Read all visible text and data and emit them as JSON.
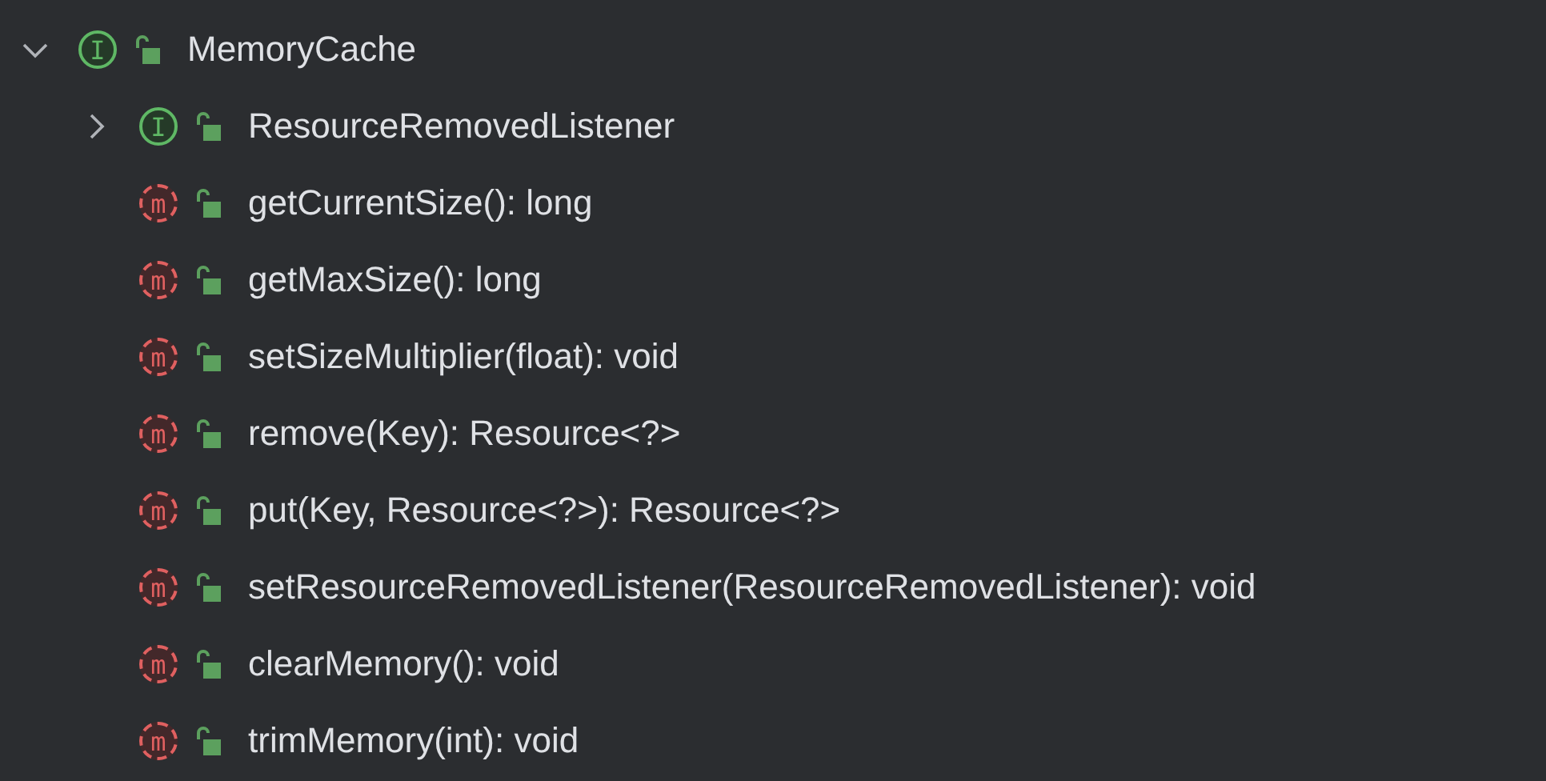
{
  "tree": [
    {
      "kind": "interface",
      "badge": "I",
      "label": "MemoryCache",
      "expanded": true,
      "children": [
        {
          "kind": "interface",
          "badge": "I",
          "label": "ResourceRemovedListener",
          "expanded": false
        },
        {
          "kind": "method",
          "badge": "m",
          "label": "getCurrentSize(): long"
        },
        {
          "kind": "method",
          "badge": "m",
          "label": "getMaxSize(): long"
        },
        {
          "kind": "method",
          "badge": "m",
          "label": "setSizeMultiplier(float): void"
        },
        {
          "kind": "method",
          "badge": "m",
          "label": "remove(Key): Resource<?>"
        },
        {
          "kind": "method",
          "badge": "m",
          "label": "put(Key, Resource<?>): Resource<?>"
        },
        {
          "kind": "method",
          "badge": "m",
          "label": "setResourceRemovedListener(ResourceRemovedListener): void"
        },
        {
          "kind": "method",
          "badge": "m",
          "label": "clearMemory(): void"
        },
        {
          "kind": "method",
          "badge": "m",
          "label": "trimMemory(int): void"
        }
      ]
    }
  ]
}
